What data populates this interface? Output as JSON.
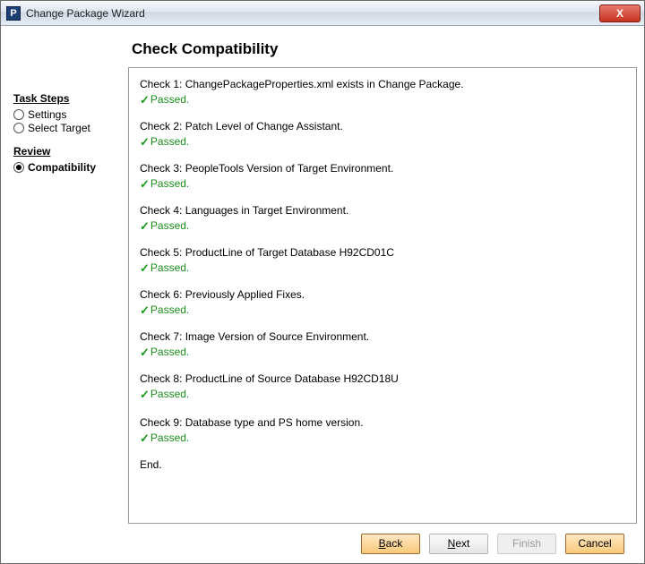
{
  "window": {
    "title": "Change Package Wizard",
    "close_label": "X",
    "app_icon_letter": "P"
  },
  "sidebar": {
    "task_steps_header": "Task Steps",
    "settings_label": "Settings",
    "select_target_label": "Select Target",
    "review_header": "Review",
    "compatibility_label": "Compatibility"
  },
  "content": {
    "heading": "Check Compatibility",
    "passed_label": "Passed.",
    "end_label": "End.",
    "checks": [
      "Check 1: ChangePackageProperties.xml exists in Change Package.",
      "Check 2: Patch Level of Change Assistant.",
      "Check 3: PeopleTools Version of Target Environment.",
      "Check 4: Languages in Target Environment.",
      "Check 5: ProductLine of Target Database H92CD01C",
      "Check 6: Previously Applied Fixes.",
      "Check 7: Image Version of Source Environment.",
      "Check 8: ProductLine of Source Database H92CD18U",
      "Check 9: Database type and PS home version."
    ]
  },
  "buttons": {
    "back": "Back",
    "next": "Next",
    "finish": "Finish",
    "cancel": "Cancel"
  }
}
